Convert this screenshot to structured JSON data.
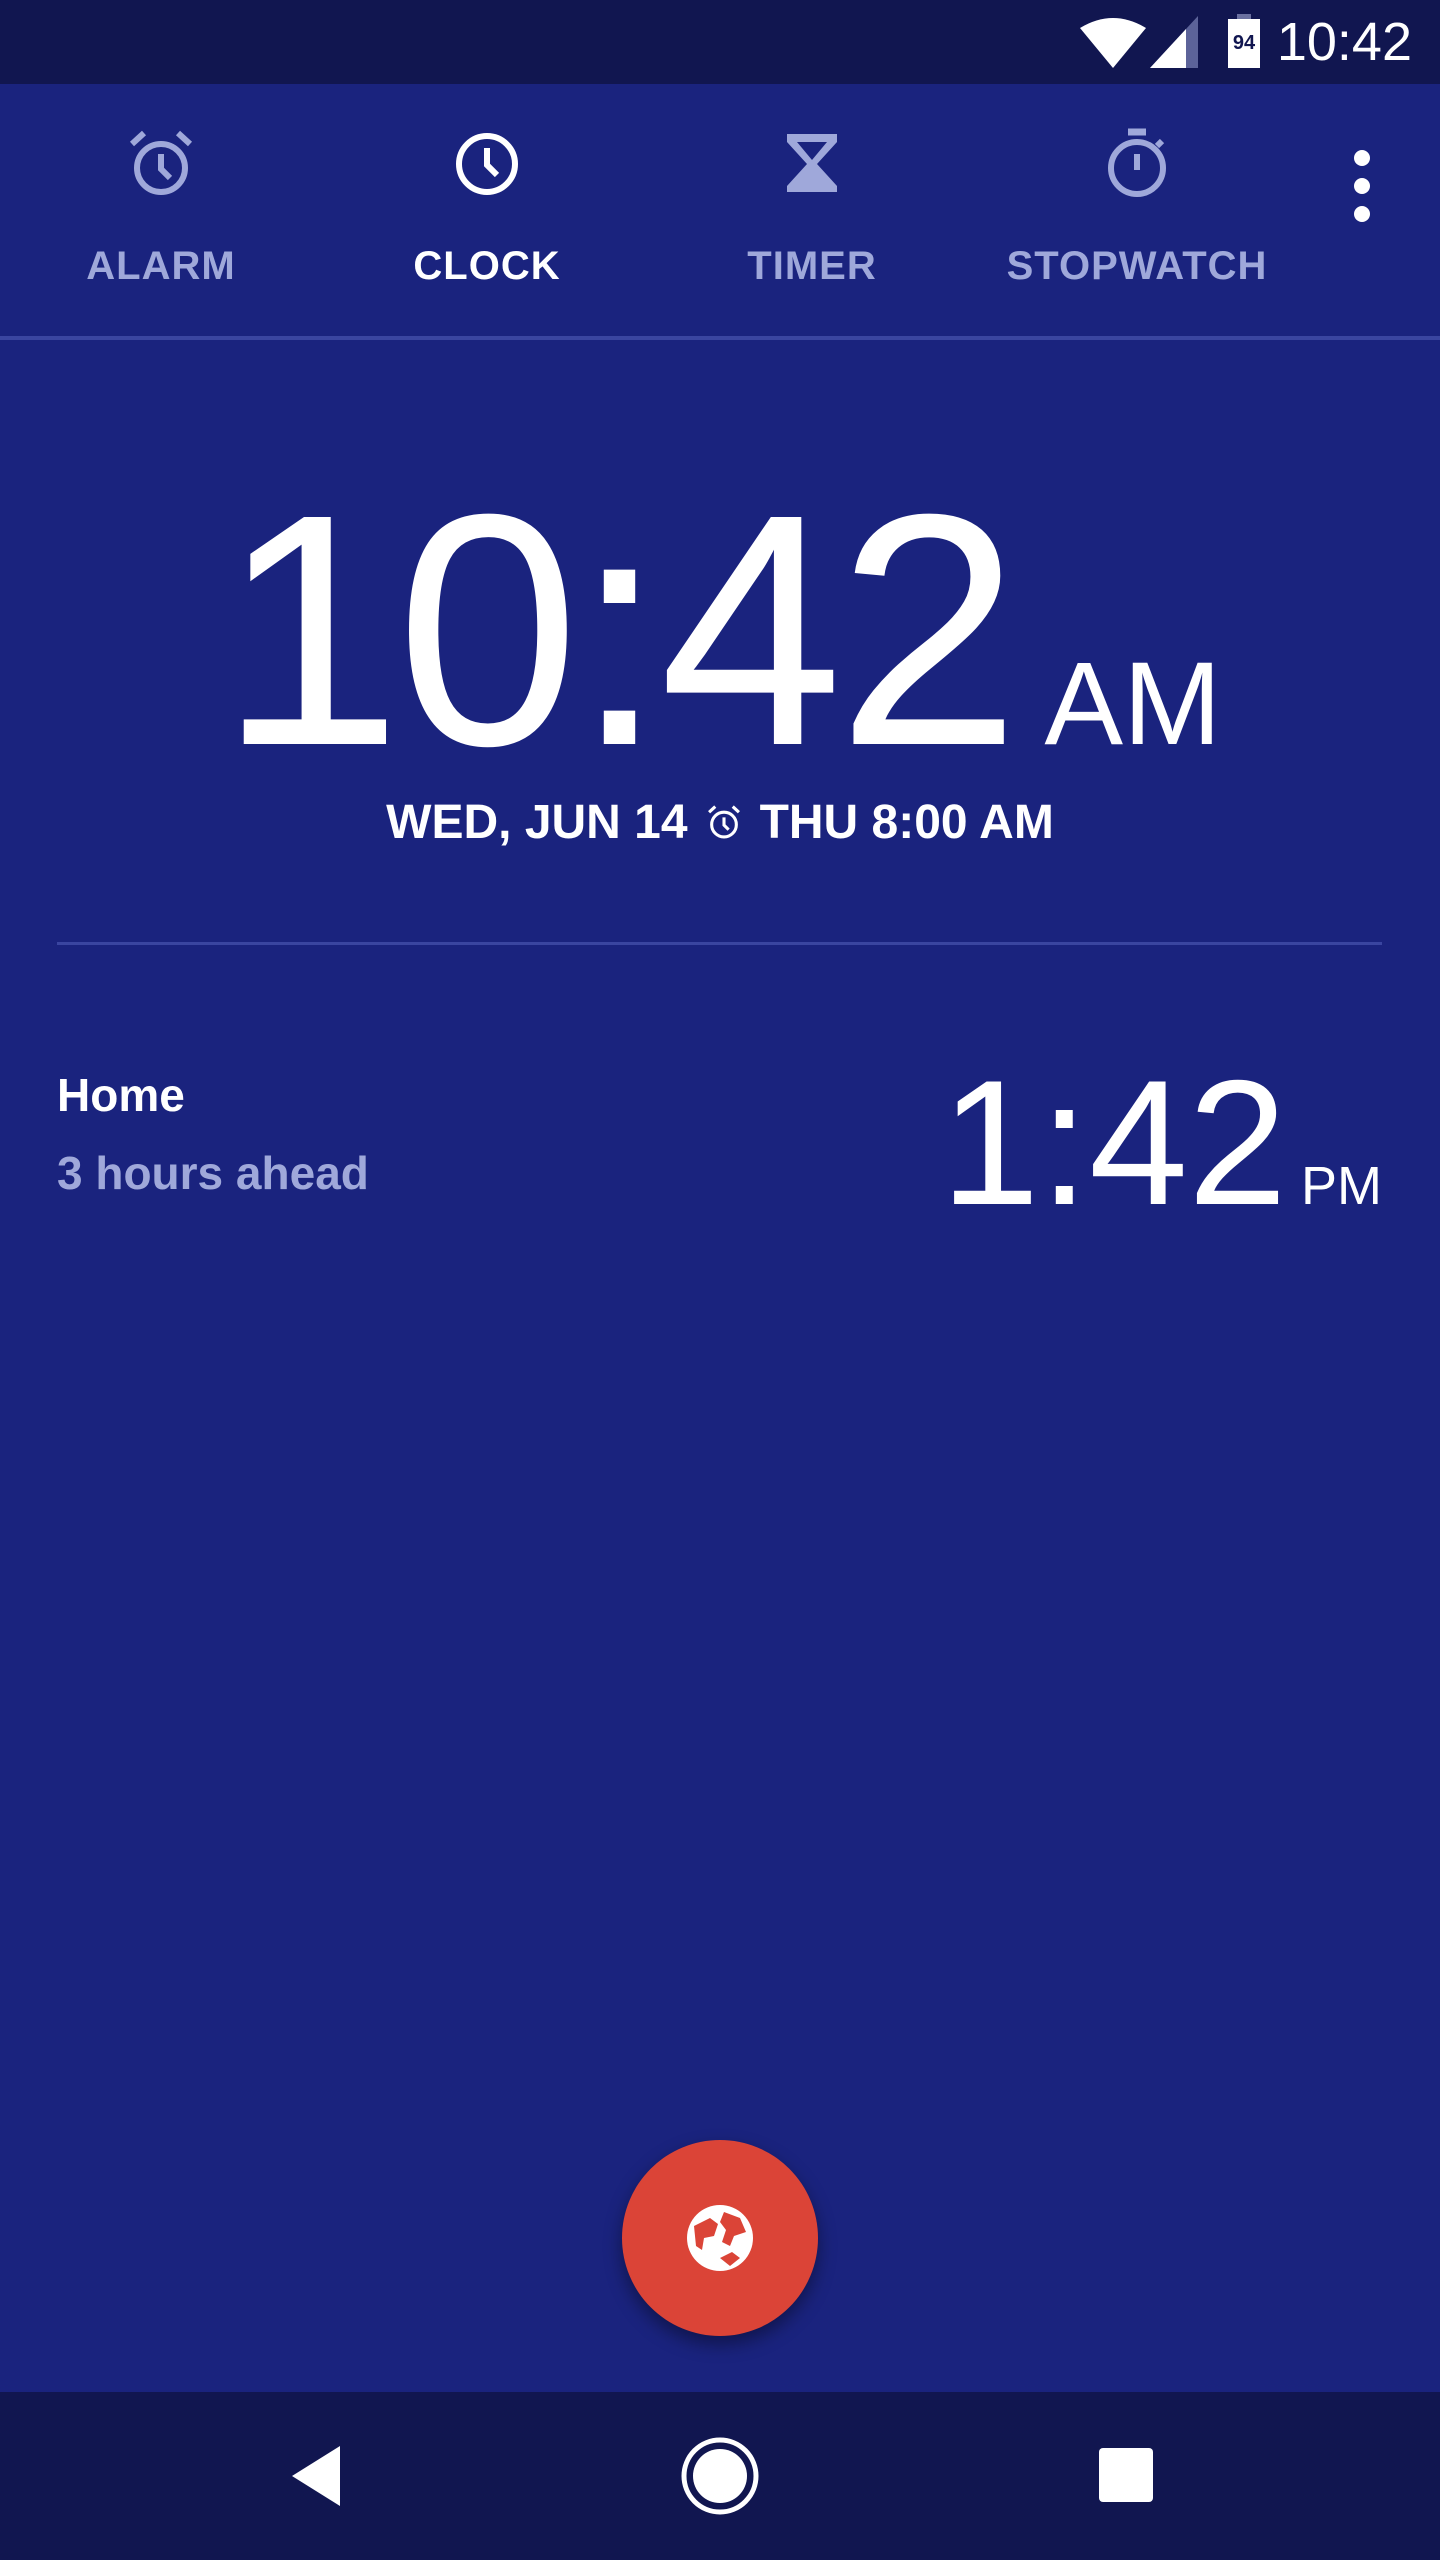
{
  "status_bar": {
    "time": "10:42",
    "battery": "94",
    "icons": [
      "wifi-icon",
      "signal-icon",
      "battery-icon"
    ]
  },
  "tabs": [
    {
      "label": "ALARM",
      "icon": "alarm-icon",
      "active": false
    },
    {
      "label": "CLOCK",
      "icon": "clock-icon",
      "active": true
    },
    {
      "label": "TIMER",
      "icon": "hourglass-icon",
      "active": false
    },
    {
      "label": "STOPWATCH",
      "icon": "stopwatch-icon",
      "active": false
    }
  ],
  "main_clock": {
    "time": "10:42",
    "ampm": "AM",
    "date": "WED, JUN 14",
    "next_alarm": "THU 8:00 AM"
  },
  "world_clocks": [
    {
      "city": "Home",
      "offset": "3 hours ahead",
      "time": "1:42",
      "ampm": "PM"
    }
  ],
  "fab": {
    "icon": "globe-icon"
  },
  "colors": {
    "background": "#1a237e",
    "bars": "#111650",
    "inactive": "#9fa8da",
    "fab": "#db4437"
  }
}
